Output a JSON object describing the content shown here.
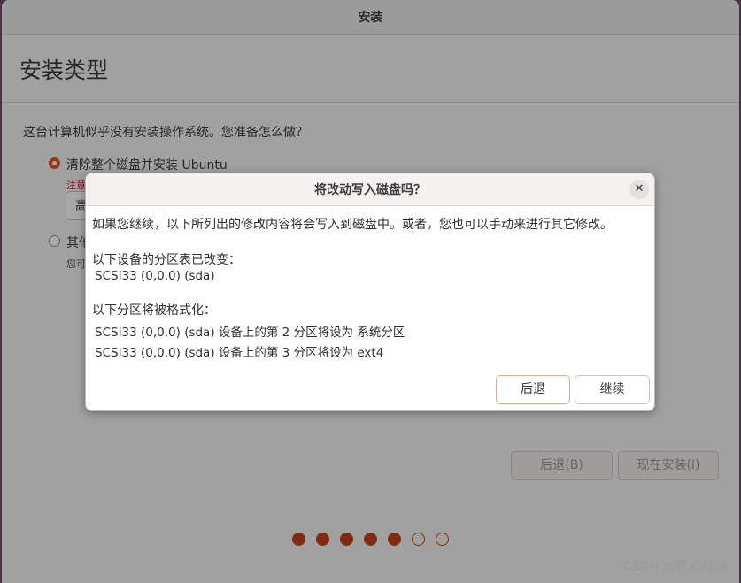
{
  "window": {
    "title": "安装"
  },
  "page": {
    "title": "安装类型",
    "question": "这台计算机似乎没有安装操作系统。您准备怎么做？",
    "options": [
      {
        "label": "清除整个磁盘并安装 Ubuntu",
        "note": "注意",
        "selected": true
      },
      {
        "label": "其他",
        "hint": "您可",
        "selected": false
      }
    ],
    "combo_value": "高"
  },
  "buttons": {
    "back": "后退(B)",
    "install_now": "现在安装(I)"
  },
  "progress": {
    "total": 7,
    "completed": 5
  },
  "dialog": {
    "title": "将改动写入磁盘吗？",
    "close_glyph": "✕",
    "intro": "如果您继续，以下所列出的修改内容将会写入到磁盘中。或者，您也可以手动来进行其它修改。",
    "partition_table_heading": "以下设备的分区表已改变：",
    "partition_table_device": "SCSI33 (0,0,0) (sda)",
    "format_heading": "以下分区将被格式化：",
    "format_items": [
      "SCSI33 (0,0,0) (sda) 设备上的第 2 分区将设为 系统分区",
      "SCSI33 (0,0,0) (sda) 设备上的第 3 分区将设为 ext4"
    ],
    "back_label": "后退",
    "continue_label": "继续"
  },
  "watermark": "CSDN @容.CAI.录",
  "colors": {
    "accent": "#e95420",
    "dot": "#c3421a"
  }
}
